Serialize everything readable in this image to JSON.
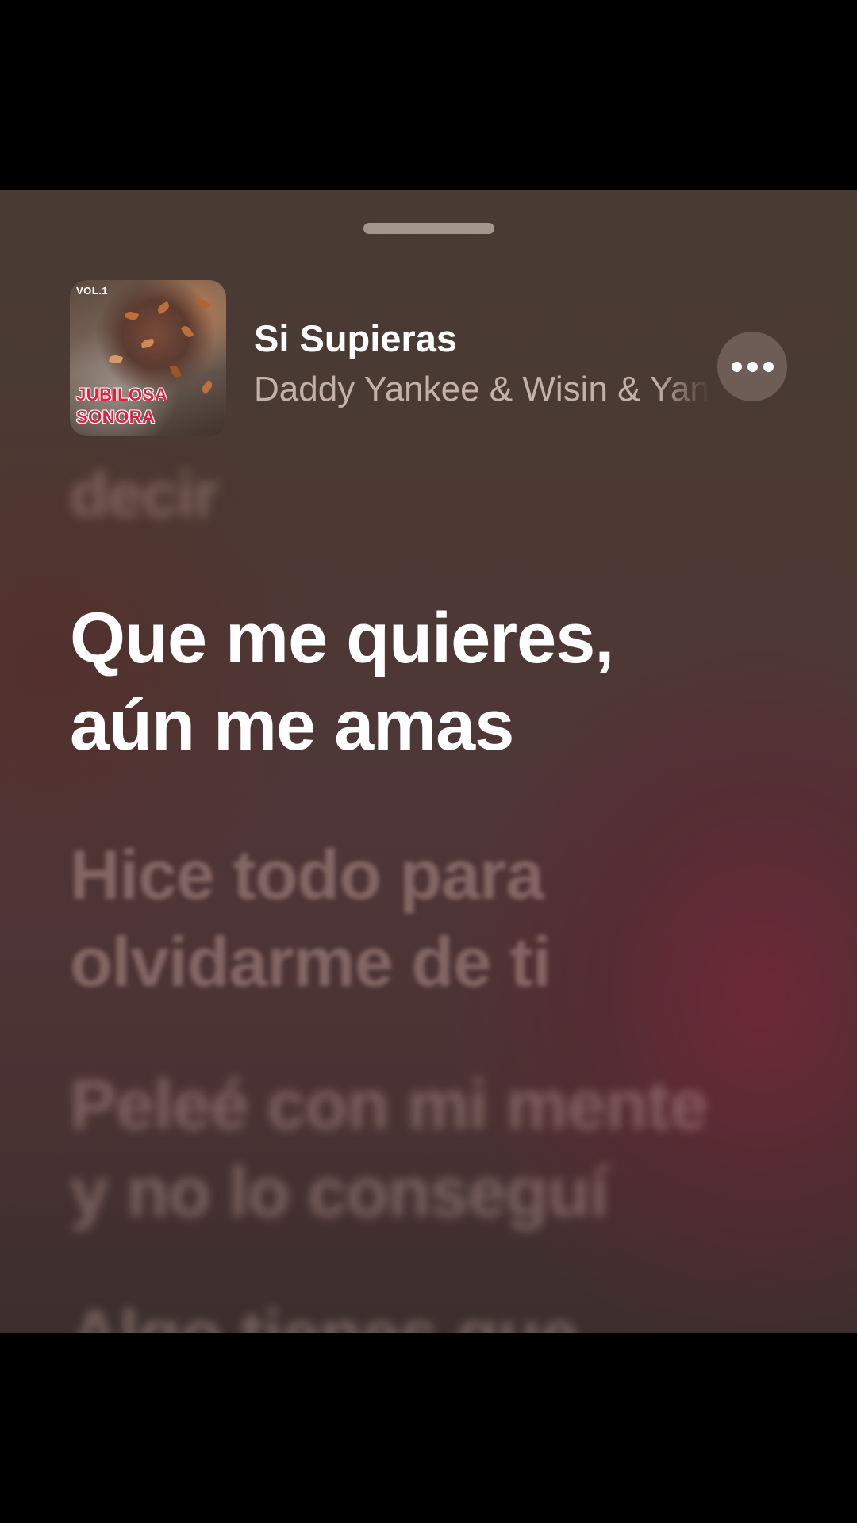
{
  "header": {
    "song_title": "Si Supieras",
    "artist": "Daddy Yankee & Wisin & Yandel",
    "artwork": {
      "vol_label": "VOL.1",
      "title_line_1": "JUBILOSA",
      "title_line_2": "SONORA"
    },
    "more_icon": "ellipsis-icon"
  },
  "lyrics": {
    "previous_line": "decir",
    "current_line_1": "Que me quieres,",
    "current_line_2": "aún me amas",
    "next_1_line_1": "Hice todo para",
    "next_1_line_2": "olvidarme de ti",
    "next_2_line_1": "Peleé con mi mente",
    "next_2_line_2": "y no lo conseguí",
    "next_3_line_1": "Algo tienes que"
  },
  "colors": {
    "background": "#4c3934",
    "accent_glow": "#6e2837",
    "current_lyric": "#ffffff"
  }
}
